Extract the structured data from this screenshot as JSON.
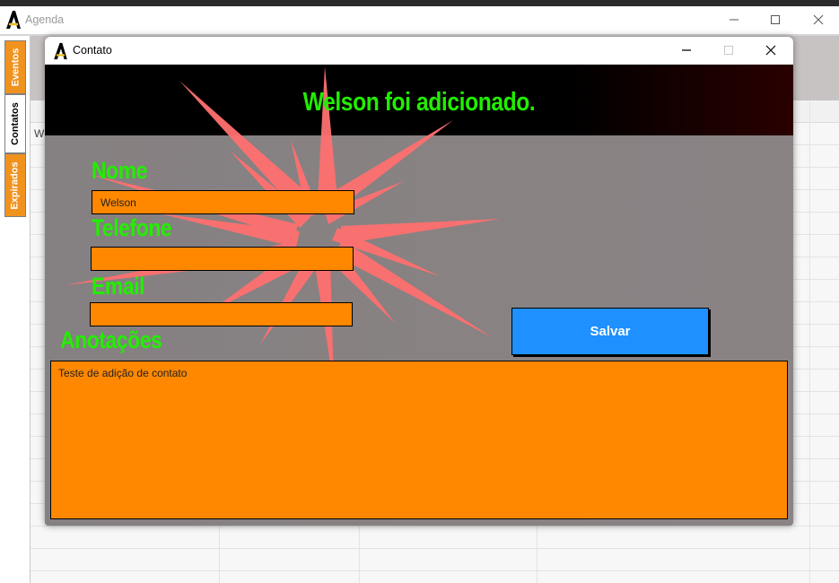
{
  "main_window": {
    "title": "Agenda",
    "grid_cell_text": "W"
  },
  "sidebar": {
    "tabs": [
      {
        "label": "Eventos",
        "selected": false
      },
      {
        "label": "Contatos",
        "selected": true
      },
      {
        "label": "Expirados",
        "selected": false
      }
    ]
  },
  "dialog": {
    "title": "Contato",
    "banner_message": "Welson foi adicionado.",
    "fields": {
      "nome_label": "Nome",
      "nome_value": "Welson",
      "telefone_label": "Telefone",
      "telefone_value": "",
      "email_label": "Email",
      "email_value": "",
      "anotacoes_label": "Anotações",
      "anotacoes_value": "Teste de adição de contato"
    },
    "save_label": "Salvar"
  },
  "colors": {
    "accent_green": "#22ee00",
    "field_orange": "#ff8800",
    "button_blue": "#1e90ff",
    "tab_orange": "#f0921e",
    "burst_red": "#ff7272"
  },
  "icons": [
    "app-logo-icon",
    "minimize-icon",
    "maximize-icon",
    "close-icon"
  ]
}
